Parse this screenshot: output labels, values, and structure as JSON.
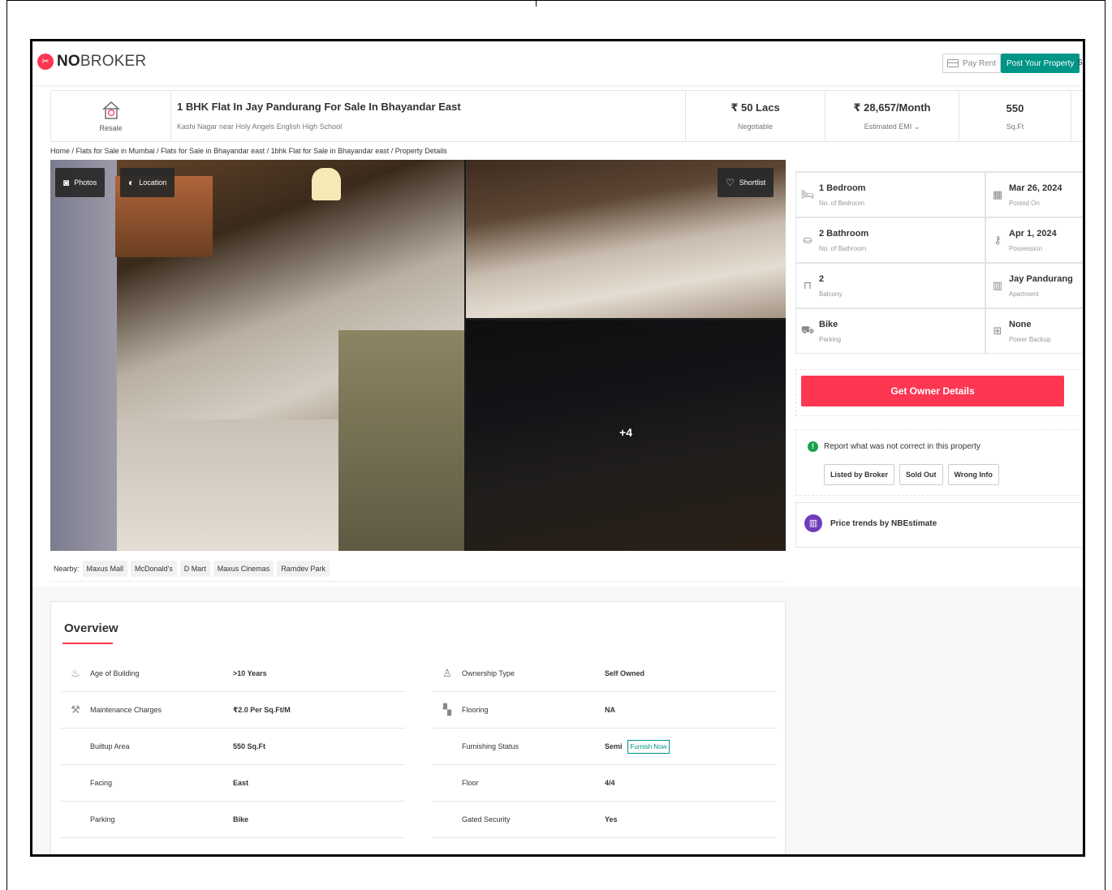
{
  "header": {
    "logo_bold": "NO",
    "logo_rest": "BROKER",
    "pay_rent": "Pay Rent",
    "post_property": "Post Your Property",
    "cut_text": "S"
  },
  "listing": {
    "type_label": "Resale",
    "title": "1 BHK Flat In Jay Pandurang For Sale In Bhayandar East",
    "subtitle": "Kashi Nagar near Holy Angels English High School",
    "price": "₹ 50 Lacs",
    "price_note": "Negotiable",
    "emi": "₹ 28,657/Month",
    "emi_note": "Estimated EMI ⌄",
    "area": "550",
    "area_unit": "Sq.Ft"
  },
  "breadcrumb": "Home / Flats for Sale in Mumbai / Flats for Sale in Bhayandar east / 1bhk Flat for Sale in Bhayandar east / Property Details",
  "gallery": {
    "photos_label": "Photos",
    "location_label": "Location",
    "shortlist_label": "Shortlist",
    "more_count": "+4"
  },
  "details": [
    {
      "icon": "bed-icon",
      "glyph": "🛏",
      "value": "1 Bedroom",
      "label": "No. of Bedroom"
    },
    {
      "icon": "calendar-icon",
      "glyph": "▦",
      "value": "Mar 26, 2024",
      "label": "Posted On"
    },
    {
      "icon": "bathtub-icon",
      "glyph": "⛀",
      "value": "2 Bathroom",
      "label": "No. of Bathroom"
    },
    {
      "icon": "key-icon",
      "glyph": "⚷",
      "value": "Apr 1, 2024",
      "label": "Possession"
    },
    {
      "icon": "balcony-icon",
      "glyph": "⊓",
      "value": "2",
      "label": "Balcony"
    },
    {
      "icon": "building-icon",
      "glyph": "▥",
      "value": "Jay Pandurang",
      "label": "Apartment"
    },
    {
      "icon": "car-icon",
      "glyph": "⛟",
      "value": "Bike",
      "label": "Parking"
    },
    {
      "icon": "battery-icon",
      "glyph": "⊞",
      "value": "None",
      "label": "Power Backup"
    }
  ],
  "owner_button": "Get Owner Details",
  "report": {
    "title": "Report what was not correct in this property",
    "tags": [
      "Listed by Broker",
      "Sold Out",
      "Wrong Info"
    ]
  },
  "trend": "Price trends by NBEstimate",
  "nearby": {
    "label": "Nearby:",
    "places": [
      "Maxus Mall",
      "McDonald's",
      "D Mart",
      "Maxus Cinemas",
      "Ramdev Park"
    ]
  },
  "overview": {
    "title": "Overview",
    "left": [
      {
        "icon": "cake-icon",
        "glyph": "♨",
        "label": "Age of Building",
        "value": ">10 Years"
      },
      {
        "icon": "tools-icon",
        "glyph": "⚒",
        "label": "Maintenance Charges",
        "value": "₹2.0 Per Sq.Ft/M"
      },
      {
        "icon": "",
        "glyph": "",
        "label": "Builtup Area",
        "value": "550 Sq.Ft"
      },
      {
        "icon": "",
        "glyph": "",
        "label": "Facing",
        "value": "East"
      },
      {
        "icon": "",
        "glyph": "",
        "label": "Parking",
        "value": "Bike"
      }
    ],
    "right": [
      {
        "icon": "owner-icon",
        "glyph": "♙",
        "label": "Ownership Type",
        "value": "Self Owned"
      },
      {
        "icon": "flooring-icon",
        "glyph": "▚",
        "label": "Flooring",
        "value": "NA"
      },
      {
        "icon": "",
        "glyph": "",
        "label": "Furnishing Status",
        "value": "Semi"
      },
      {
        "icon": "",
        "glyph": "",
        "label": "Floor",
        "value": "4/4"
      },
      {
        "icon": "",
        "glyph": "",
        "label": "Gated Security",
        "value": "Yes"
      }
    ],
    "furnish_now": "Furnish Now"
  },
  "colors": {
    "brand": "#fd3752",
    "accent": "#009587"
  }
}
